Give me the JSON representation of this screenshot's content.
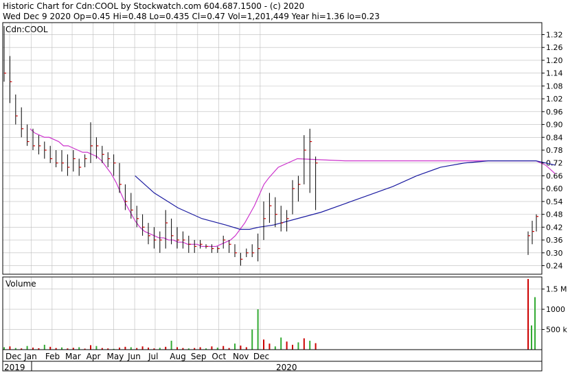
{
  "header": {
    "line1": "Historic Chart for Cdn:COOL by Stockwatch.com 604.687.1500 - (c) 2020",
    "line2": "Wed Dec  9 2020  Op=0.45  Hi=0.48  Lo=0.435  Cl=0.47  Vol=1,201,449  Year hi=1.36  lo=0.23"
  },
  "colors": {
    "bar": "#000000",
    "tick_up": "#cc0000",
    "ma_short": "#cc33cc",
    "ma_long": "#1a1aa0",
    "volume_green": "#33aa33",
    "volume_red": "#cc0000",
    "grid": "#bbbbbb"
  },
  "chart_data": [
    {
      "type": "line",
      "panel": "price",
      "title": "Cdn:COOL",
      "ylim": [
        0.2,
        1.36
      ],
      "y_ticks": [
        1.32,
        1.26,
        1.2,
        1.14,
        1.08,
        1.02,
        0.96,
        0.9,
        0.84,
        0.78,
        0.72,
        0.66,
        0.6,
        0.54,
        0.48,
        0.42,
        0.36,
        0.3,
        0.24
      ],
      "y_tick_labels": [
        "1.32",
        "1.26",
        "1.20",
        "1.14",
        "1.08",
        "1.02",
        "0.96",
        "0.90",
        "0.84",
        "0.78",
        "0.72",
        "0.66",
        "0.60",
        "0.54",
        "0.48",
        "0.42",
        "0.36",
        "0.30",
        "0.24"
      ],
      "grid": true,
      "x_units": "weeks from start of December 2019",
      "series": [
        {
          "kind": "hlc_bars",
          "x": [
            0,
            1,
            2,
            3,
            4,
            5,
            6,
            7,
            8,
            9,
            10,
            11,
            12,
            13,
            14,
            15,
            16,
            17,
            18,
            19,
            20,
            21,
            22,
            23,
            24,
            25,
            26,
            27,
            28,
            29,
            30,
            31,
            32,
            33,
            34,
            35,
            36,
            37,
            38,
            39,
            40,
            41,
            42,
            43,
            44,
            45,
            46,
            47,
            48,
            49,
            50,
            51,
            52,
            53,
            54
          ],
          "high": [
            1.36,
            1.22,
            1.04,
            0.98,
            0.9,
            0.88,
            0.85,
            0.82,
            0.8,
            0.78,
            0.78,
            0.76,
            0.78,
            0.74,
            0.76,
            0.91,
            0.84,
            0.8,
            0.77,
            0.76,
            0.72,
            0.62,
            0.58,
            0.52,
            0.48,
            0.44,
            0.42,
            0.4,
            0.5,
            0.46,
            0.42,
            0.4,
            0.38,
            0.36,
            0.36,
            0.34,
            0.34,
            0.33,
            0.38,
            0.36,
            0.34,
            0.3,
            0.32,
            0.34,
            0.39,
            0.54,
            0.58,
            0.56,
            0.52,
            0.5,
            0.64,
            0.66,
            0.85,
            0.88,
            0.75
          ],
          "low": [
            1.1,
            1.0,
            0.9,
            0.84,
            0.8,
            0.78,
            0.76,
            0.74,
            0.72,
            0.7,
            0.68,
            0.66,
            0.68,
            0.66,
            0.7,
            0.72,
            0.74,
            0.72,
            0.7,
            0.66,
            0.58,
            0.5,
            0.46,
            0.42,
            0.38,
            0.34,
            0.32,
            0.3,
            0.32,
            0.34,
            0.32,
            0.32,
            0.3,
            0.3,
            0.32,
            0.32,
            0.3,
            0.3,
            0.32,
            0.3,
            0.28,
            0.24,
            0.28,
            0.28,
            0.26,
            0.36,
            0.44,
            0.42,
            0.4,
            0.4,
            0.48,
            0.54,
            0.62,
            0.58,
            0.5
          ],
          "close": [
            1.14,
            1.1,
            0.94,
            0.88,
            0.82,
            0.8,
            0.8,
            0.78,
            0.74,
            0.72,
            0.72,
            0.7,
            0.74,
            0.7,
            0.74,
            0.8,
            0.8,
            0.76,
            0.74,
            0.72,
            0.62,
            0.54,
            0.5,
            0.46,
            0.42,
            0.38,
            0.36,
            0.36,
            0.44,
            0.38,
            0.36,
            0.36,
            0.34,
            0.33,
            0.34,
            0.33,
            0.32,
            0.32,
            0.36,
            0.34,
            0.3,
            0.27,
            0.3,
            0.3,
            0.32,
            0.46,
            0.52,
            0.48,
            0.44,
            0.46,
            0.6,
            0.62,
            0.78,
            0.82,
            0.72
          ]
        },
        {
          "kind": "hlc_bars",
          "x": [
            55,
            56,
            57
          ],
          "high": [
            0.4,
            0.45,
            0.48
          ],
          "low": [
            0.29,
            0.34,
            0.4
          ],
          "close": [
            0.38,
            0.4,
            0.47
          ]
        },
        {
          "name": "",
          "kind": "moving_average_short",
          "x": [
            4,
            5,
            6,
            7,
            8,
            9,
            10,
            11,
            12,
            13,
            14,
            15,
            16,
            17,
            18,
            19,
            20,
            21,
            22,
            23,
            24,
            25,
            26,
            27,
            28,
            29,
            30,
            31,
            32,
            33,
            34,
            35,
            36,
            37,
            38,
            39,
            40,
            41,
            42,
            43,
            44,
            45,
            46,
            47,
            48,
            49,
            50,
            51,
            52,
            53,
            54,
            56,
            60,
            70,
            80,
            90,
            100,
            110,
            112,
            114
          ],
          "y": [
            0.88,
            0.86,
            0.85,
            0.84,
            0.84,
            0.83,
            0.82,
            0.8,
            0.8,
            0.79,
            0.78,
            0.77,
            0.77,
            0.76,
            0.75,
            0.73,
            0.7,
            0.67,
            0.63,
            0.58,
            0.53,
            0.49,
            0.45,
            0.42,
            0.4,
            0.39,
            0.38,
            0.37,
            0.37,
            0.36,
            0.36,
            0.35,
            0.35,
            0.34,
            0.34,
            0.34,
            0.33,
            0.33,
            0.33,
            0.33,
            0.34,
            0.35,
            0.36,
            0.38,
            0.41,
            0.44,
            0.48,
            0.52,
            0.57,
            0.62,
            0.65,
            0.7,
            0.74,
            0.73,
            0.73,
            0.73,
            0.73,
            0.73,
            0.71,
            0.67
          ]
        },
        {
          "name": "",
          "kind": "moving_average_long",
          "x": [
            26,
            30,
            35,
            40,
            45,
            48,
            50,
            52,
            55,
            60,
            65,
            70,
            75,
            80,
            85,
            90,
            95,
            100,
            104,
            108,
            110,
            112,
            114
          ],
          "y": [
            0.66,
            0.58,
            0.51,
            0.46,
            0.43,
            0.41,
            0.41,
            0.42,
            0.43,
            0.46,
            0.49,
            0.53,
            0.57,
            0.61,
            0.66,
            0.7,
            0.72,
            0.73,
            0.73,
            0.73,
            0.73,
            0.72,
            0.71
          ]
        }
      ],
      "x_tick_labels": [
        "Dec",
        "Jan",
        "Feb",
        "Mar",
        "Apr",
        "May",
        "Jun",
        "Jul",
        "Aug",
        "Sep",
        "Oct",
        "Nov",
        "Dec"
      ],
      "x_tick_weeks": [
        0,
        4.5,
        8.9,
        13.1,
        17.5,
        21.8,
        26.2,
        30.5,
        35,
        39.4,
        43.8,
        48.2,
        52.5
      ],
      "year_labels": [
        "2019",
        "2020"
      ]
    },
    {
      "type": "bar",
      "panel": "volume",
      "title": "Volume",
      "ylim": [
        0,
        1800000
      ],
      "y_ticks": [
        500000,
        1000000,
        1500000
      ],
      "y_tick_labels": [
        "500 k",
        "1000",
        "1.5 M"
      ],
      "x_units": "weeks from start of December 2019",
      "bars": [
        {
          "x": 0,
          "v": 60000,
          "c": "green"
        },
        {
          "x": 1,
          "v": 80000,
          "c": "red"
        },
        {
          "x": 2,
          "v": 40000,
          "c": "green"
        },
        {
          "x": 3,
          "v": 30000,
          "c": "red"
        },
        {
          "x": 4,
          "v": 90000,
          "c": "green"
        },
        {
          "x": 5,
          "v": 50000,
          "c": "red"
        },
        {
          "x": 6,
          "v": 35000,
          "c": "red"
        },
        {
          "x": 7,
          "v": 120000,
          "c": "green"
        },
        {
          "x": 8,
          "v": 70000,
          "c": "red"
        },
        {
          "x": 9,
          "v": 40000,
          "c": "red"
        },
        {
          "x": 10,
          "v": 55000,
          "c": "green"
        },
        {
          "x": 11,
          "v": 30000,
          "c": "red"
        },
        {
          "x": 12,
          "v": 45000,
          "c": "red"
        },
        {
          "x": 13,
          "v": 60000,
          "c": "green"
        },
        {
          "x": 14,
          "v": 25000,
          "c": "red"
        },
        {
          "x": 15,
          "v": 110000,
          "c": "red"
        },
        {
          "x": 16,
          "v": 90000,
          "c": "green"
        },
        {
          "x": 17,
          "v": 40000,
          "c": "red"
        },
        {
          "x": 18,
          "v": 30000,
          "c": "red"
        },
        {
          "x": 19,
          "v": 20000,
          "c": "green"
        },
        {
          "x": 20,
          "v": 50000,
          "c": "red"
        },
        {
          "x": 21,
          "v": 70000,
          "c": "red"
        },
        {
          "x": 22,
          "v": 60000,
          "c": "green"
        },
        {
          "x": 23,
          "v": 40000,
          "c": "red"
        },
        {
          "x": 24,
          "v": 80000,
          "c": "red"
        },
        {
          "x": 25,
          "v": 50000,
          "c": "red"
        },
        {
          "x": 26,
          "v": 30000,
          "c": "red"
        },
        {
          "x": 27,
          "v": 45000,
          "c": "green"
        },
        {
          "x": 28,
          "v": 70000,
          "c": "red"
        },
        {
          "x": 29,
          "v": 220000,
          "c": "green"
        },
        {
          "x": 30,
          "v": 60000,
          "c": "red"
        },
        {
          "x": 31,
          "v": 40000,
          "c": "red"
        },
        {
          "x": 32,
          "v": 30000,
          "c": "green"
        },
        {
          "x": 33,
          "v": 40000,
          "c": "red"
        },
        {
          "x": 34,
          "v": 60000,
          "c": "red"
        },
        {
          "x": 35,
          "v": 30000,
          "c": "green"
        },
        {
          "x": 36,
          "v": 80000,
          "c": "red"
        },
        {
          "x": 37,
          "v": 50000,
          "c": "green"
        },
        {
          "x": 38,
          "v": 90000,
          "c": "red"
        },
        {
          "x": 39,
          "v": 40000,
          "c": "red"
        },
        {
          "x": 40,
          "v": 150000,
          "c": "green"
        },
        {
          "x": 41,
          "v": 100000,
          "c": "red"
        },
        {
          "x": 42,
          "v": 60000,
          "c": "red"
        },
        {
          "x": 43,
          "v": 500000,
          "c": "green"
        },
        {
          "x": 44,
          "v": 1000000,
          "c": "green"
        },
        {
          "x": 45,
          "v": 250000,
          "c": "red"
        },
        {
          "x": 46,
          "v": 150000,
          "c": "red"
        },
        {
          "x": 47,
          "v": 80000,
          "c": "green"
        },
        {
          "x": 48,
          "v": 300000,
          "c": "green"
        },
        {
          "x": 49,
          "v": 200000,
          "c": "red"
        },
        {
          "x": 50,
          "v": 120000,
          "c": "red"
        },
        {
          "x": 51,
          "v": 180000,
          "c": "green"
        },
        {
          "x": 52,
          "v": 280000,
          "c": "red"
        },
        {
          "x": 53,
          "v": 220000,
          "c": "green"
        },
        {
          "x": 54,
          "v": 160000,
          "c": "red"
        },
        {
          "x": 55,
          "v": 1750000,
          "c": "red"
        },
        {
          "x": 56,
          "v": 600000,
          "c": "green"
        },
        {
          "x": 57,
          "v": 1300000,
          "c": "green"
        }
      ]
    }
  ]
}
